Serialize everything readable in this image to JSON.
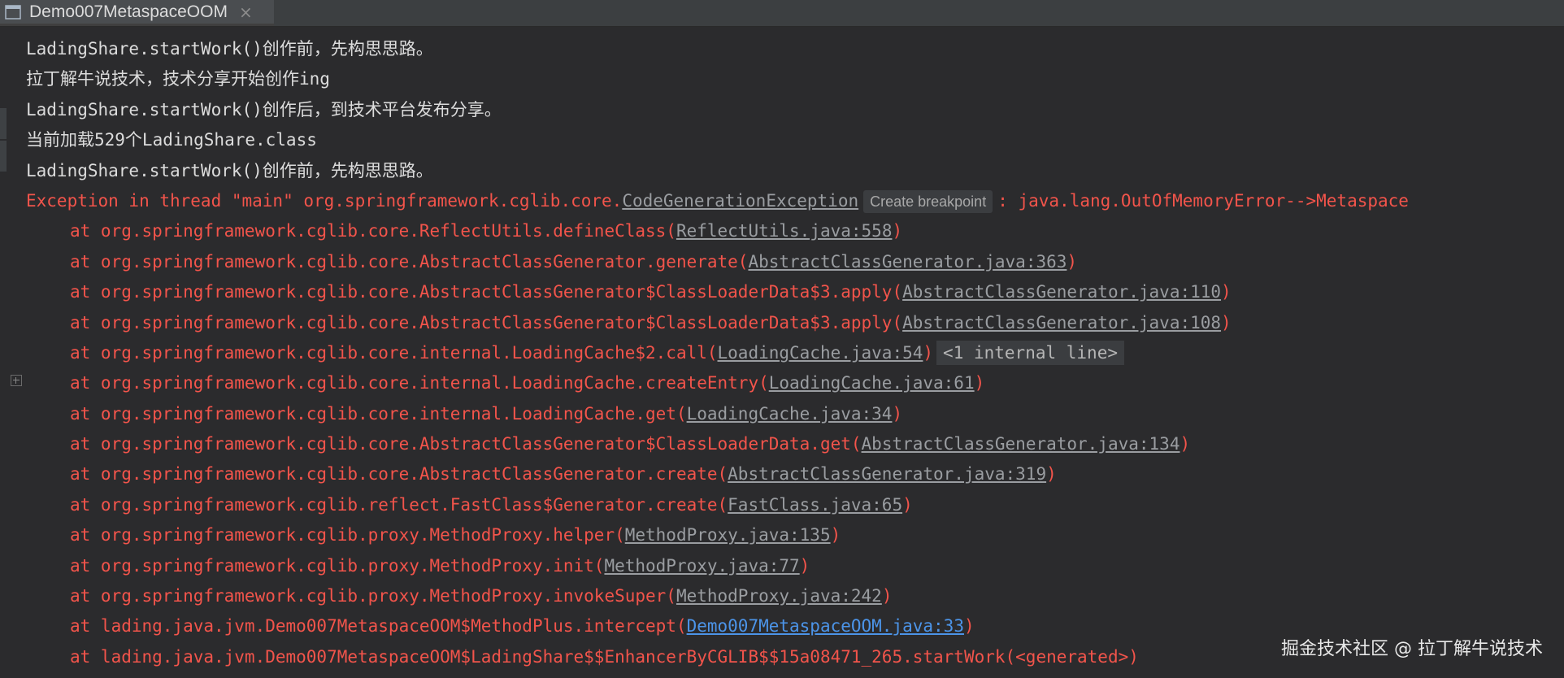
{
  "tab": {
    "title": "Demo007MetaspaceOOM",
    "close": "×"
  },
  "output": [
    "LadingShare.startWork()创作前，先构思思路。",
    "拉丁解牛说技术，技术分享开始创作ing",
    "LadingShare.startWork()创作后，到技术平台发布分享。",
    "当前加载529个LadingShare.class",
    "LadingShare.startWork()创作前，先构思思路。"
  ],
  "exception": {
    "prefix": "Exception in thread \"main\" org.springframework.cglib.core.",
    "class_link": "CodeGenerationException",
    "hint": "Create breakpoint",
    "suffix": ": java.lang.OutOfMemoryError-->Metaspace"
  },
  "stack": [
    {
      "text": "at org.springframework.cglib.core.ReflectUtils.defineClass(",
      "link": "ReflectUtils.java:558",
      "end": ")"
    },
    {
      "text": "at org.springframework.cglib.core.AbstractClassGenerator.generate(",
      "link": "AbstractClassGenerator.java:363",
      "end": ")"
    },
    {
      "text": "at org.springframework.cglib.core.AbstractClassGenerator$ClassLoaderData$3.apply(",
      "link": "AbstractClassGenerator.java:110",
      "end": ")"
    },
    {
      "text": "at org.springframework.cglib.core.AbstractClassGenerator$ClassLoaderData$3.apply(",
      "link": "AbstractClassGenerator.java:108",
      "end": ")"
    },
    {
      "text": "at org.springframework.cglib.core.internal.LoadingCache$2.call(",
      "link": "LoadingCache.java:54",
      "end": ")",
      "collapsed": "<1 internal line>"
    },
    {
      "text": "at org.springframework.cglib.core.internal.LoadingCache.createEntry(",
      "link": "LoadingCache.java:61",
      "end": ")"
    },
    {
      "text": "at org.springframework.cglib.core.internal.LoadingCache.get(",
      "link": "LoadingCache.java:34",
      "end": ")"
    },
    {
      "text": "at org.springframework.cglib.core.AbstractClassGenerator$ClassLoaderData.get(",
      "link": "AbstractClassGenerator.java:134",
      "end": ")"
    },
    {
      "text": "at org.springframework.cglib.core.AbstractClassGenerator.create(",
      "link": "AbstractClassGenerator.java:319",
      "end": ")"
    },
    {
      "text": "at org.springframework.cglib.reflect.FastClass$Generator.create(",
      "link": "FastClass.java:65",
      "end": ")"
    },
    {
      "text": "at org.springframework.cglib.proxy.MethodProxy.helper(",
      "link": "MethodProxy.java:135",
      "end": ")"
    },
    {
      "text": "at org.springframework.cglib.proxy.MethodProxy.init(",
      "link": "MethodProxy.java:77",
      "end": ")"
    },
    {
      "text": "at org.springframework.cglib.proxy.MethodProxy.invokeSuper(",
      "link": "MethodProxy.java:242",
      "end": ")"
    },
    {
      "text": "at lading.java.jvm.Demo007MetaspaceOOM$MethodPlus.intercept(",
      "link": "Demo007MetaspaceOOM.java:33",
      "end": ")",
      "user_code": true
    },
    {
      "text": "at lading.java.jvm.Demo007MetaspaceOOM$LadingShare$$EnhancerByCGLIB$$15a08471_265.startWork(<generated>)",
      "link": "",
      "end": ""
    }
  ],
  "watermark": "掘金技术社区 @ 拉丁解牛说技术",
  "colors": {
    "background": "#2b2b2d",
    "stdout": "#dcdcdc",
    "stderr": "#f2544b",
    "link": "#9a9da1",
    "user_link": "#4c94e8"
  },
  "icons": {
    "tab": "console-window-icon",
    "fold": "expand-fold-icon"
  }
}
